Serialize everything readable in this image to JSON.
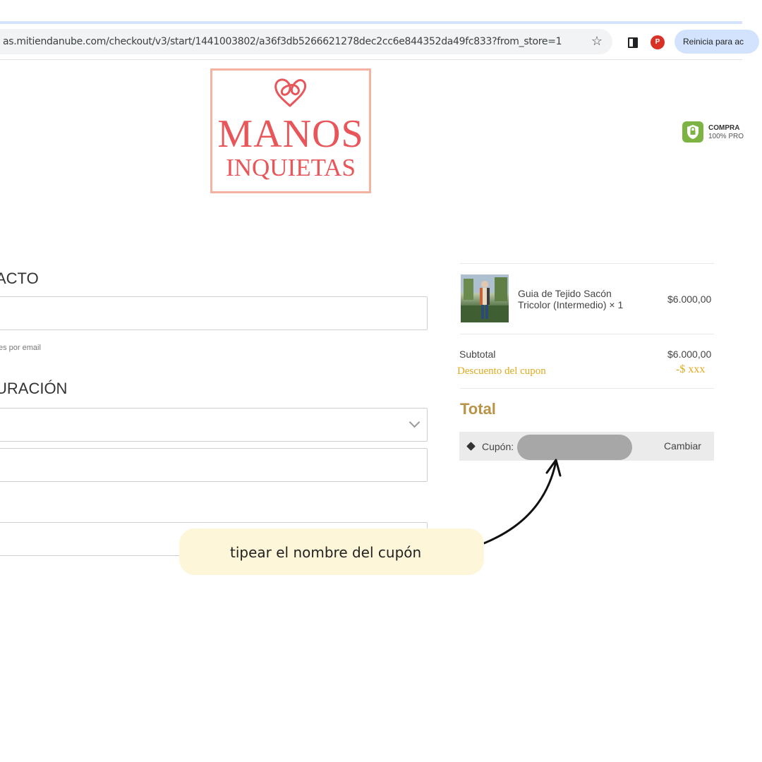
{
  "browser": {
    "url": "as.mitiendanube.com/checkout/v3/start/1441003802/a36f3db5266621278dec2cc6e844352da49fc833?from_store=1",
    "profile_initial": "P",
    "restart_label": "Reinicia para ac"
  },
  "logo": {
    "line1": "MANOS",
    "line2": "INQUIETAS"
  },
  "secure": {
    "title": "COMPRA",
    "subtitle": "100% PRO"
  },
  "form": {
    "contact_heading": "ACTO",
    "newsletter_note": "es por email",
    "shipping_heading": "URACIÓN"
  },
  "summary": {
    "product_name": "Guia de Tejido Sacón Tricolor (Intermedio) × 1",
    "product_price": "$6.000,00",
    "subtotal_label": "Subtotal",
    "subtotal_value": "$6.000,00",
    "discount_label": "Descuento del cupon",
    "discount_value": "-$ xxx",
    "total_label": "Total",
    "coupon_label": "Cupón:",
    "change_label": "Cambiar"
  },
  "annotation": {
    "text": "tipear el nombre del cupón"
  },
  "colors": {
    "logo": "#e8565a",
    "logo_border": "#f4b3a0",
    "discount": "#e0a91e",
    "total": "#b99346",
    "callout_bg": "#fdf6d8"
  },
  "icons": [
    "star-icon",
    "side-panel-icon",
    "heart-logo-icon",
    "shield-lock-icon",
    "chevron-down-icon",
    "tag-icon",
    "arrow-icon"
  ]
}
